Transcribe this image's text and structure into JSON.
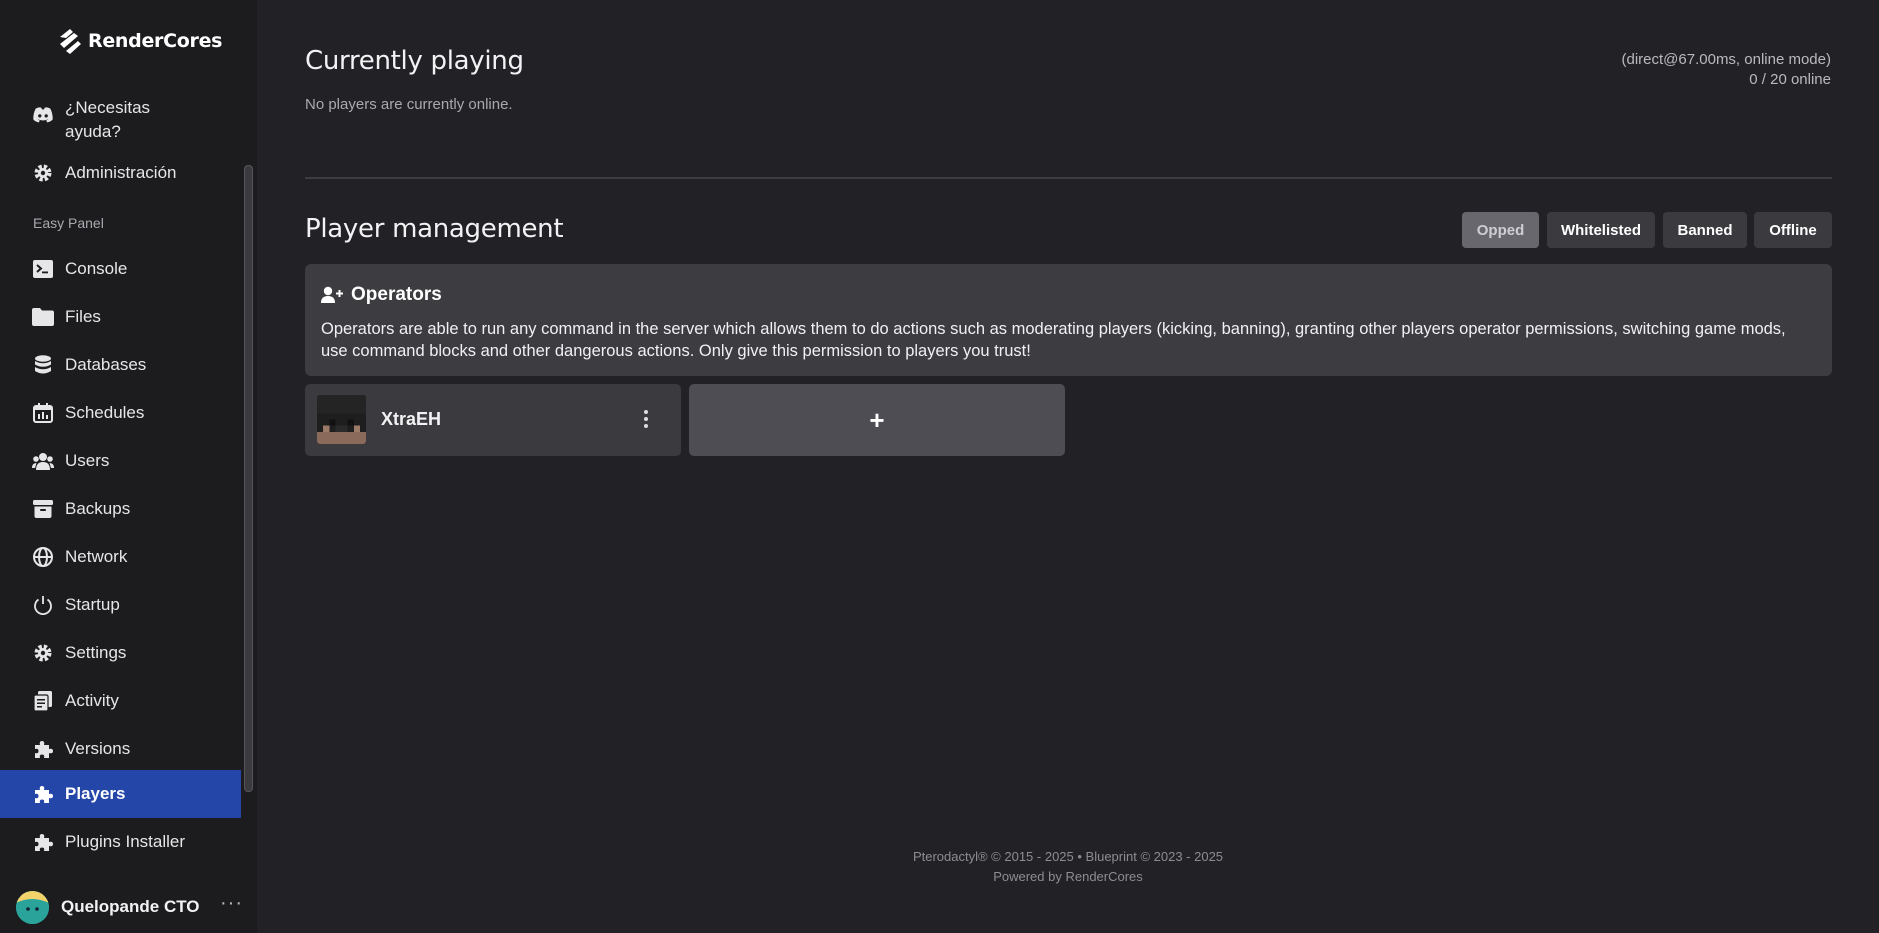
{
  "app": {
    "brand": "RenderCores"
  },
  "sidebar": {
    "help_label": "¿Necesitas ayuda?",
    "admin_label": "Administración",
    "section_label": "Easy Panel",
    "items": [
      {
        "label": "Console",
        "icon": "terminal-icon"
      },
      {
        "label": "Files",
        "icon": "folder-icon"
      },
      {
        "label": "Databases",
        "icon": "database-icon"
      },
      {
        "label": "Schedules",
        "icon": "calendar-icon"
      },
      {
        "label": "Users",
        "icon": "users-icon"
      },
      {
        "label": "Backups",
        "icon": "archive-icon"
      },
      {
        "label": "Network",
        "icon": "globe-icon"
      },
      {
        "label": "Startup",
        "icon": "power-icon"
      },
      {
        "label": "Settings",
        "icon": "gear-icon"
      },
      {
        "label": "Activity",
        "icon": "clipboard-icon"
      },
      {
        "label": "Versions",
        "icon": "puzzle-icon"
      },
      {
        "label": "Players",
        "icon": "puzzle-icon",
        "active": true
      },
      {
        "label": "Plugins Installer",
        "icon": "puzzle-icon"
      }
    ],
    "user": {
      "name": "Quelopande CTO",
      "more": "···"
    }
  },
  "main": {
    "currently_playing": {
      "title": "Currently playing",
      "empty_text": "No players are currently online.",
      "connection": "(direct@67.00ms, online mode)",
      "online_count": "0 / 20 online"
    },
    "player_management": {
      "title": "Player management",
      "filters": [
        "Opped",
        "Whitelisted",
        "Banned",
        "Offline"
      ],
      "active_filter": "Opped",
      "info": {
        "title": "Operators",
        "text": "Operators are able to run any command in the server which allows them to do actions such as moderating players (kicking, banning), granting other players operator permissions, switching game mods, use command blocks and other dangerous actions. Only give this permission to players you trust!"
      },
      "players": [
        {
          "name": "XtraEH"
        }
      ],
      "add_label": "+"
    }
  },
  "footer": {
    "line1": "Pterodactyl® © 2015 - 2025  •  Blueprint © 2023 - 2025",
    "line2": "Powered by RenderCores"
  },
  "colors": {
    "accent": "#2446a8",
    "background": "#222226",
    "sidebar": "#1c1c1f",
    "card": "#3c3c41"
  }
}
